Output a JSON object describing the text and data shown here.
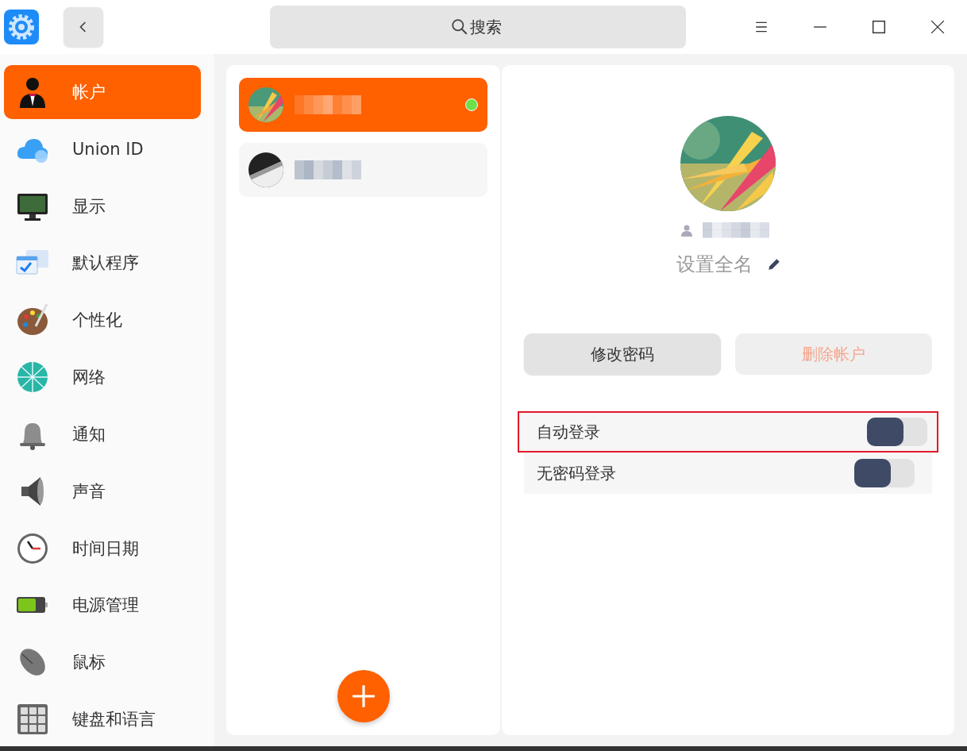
{
  "titlebar": {
    "search": {
      "placeholder": "搜索"
    }
  },
  "sidebar": {
    "items": [
      {
        "label": "帐户",
        "selected": true
      },
      {
        "label": "Union ID",
        "selected": false
      },
      {
        "label": "显示",
        "selected": false
      },
      {
        "label": "默认程序",
        "selected": false
      },
      {
        "label": "个性化",
        "selected": false
      },
      {
        "label": "网络",
        "selected": false
      },
      {
        "label": "通知",
        "selected": false
      },
      {
        "label": "声音",
        "selected": false
      },
      {
        "label": "时间日期",
        "selected": false
      },
      {
        "label": "电源管理",
        "selected": false
      },
      {
        "label": "鼠标",
        "selected": false
      },
      {
        "label": "键盘和语言",
        "selected": false
      }
    ]
  },
  "accounts": [
    {
      "selected": true,
      "online": true,
      "name_pixelated": true
    },
    {
      "selected": false,
      "online": false,
      "name_pixelated": true
    }
  ],
  "detail": {
    "username_pixelated": true,
    "fullname_placeholder": "设置全名",
    "buttons": [
      {
        "label": "修改密码",
        "disabled": false
      },
      {
        "label": "删除帐户",
        "disabled": true
      }
    ],
    "settings": [
      {
        "label": "自动登录",
        "on": false,
        "highlighted": true
      },
      {
        "label": "无密码登录",
        "on": false,
        "highlighted": false
      }
    ]
  }
}
